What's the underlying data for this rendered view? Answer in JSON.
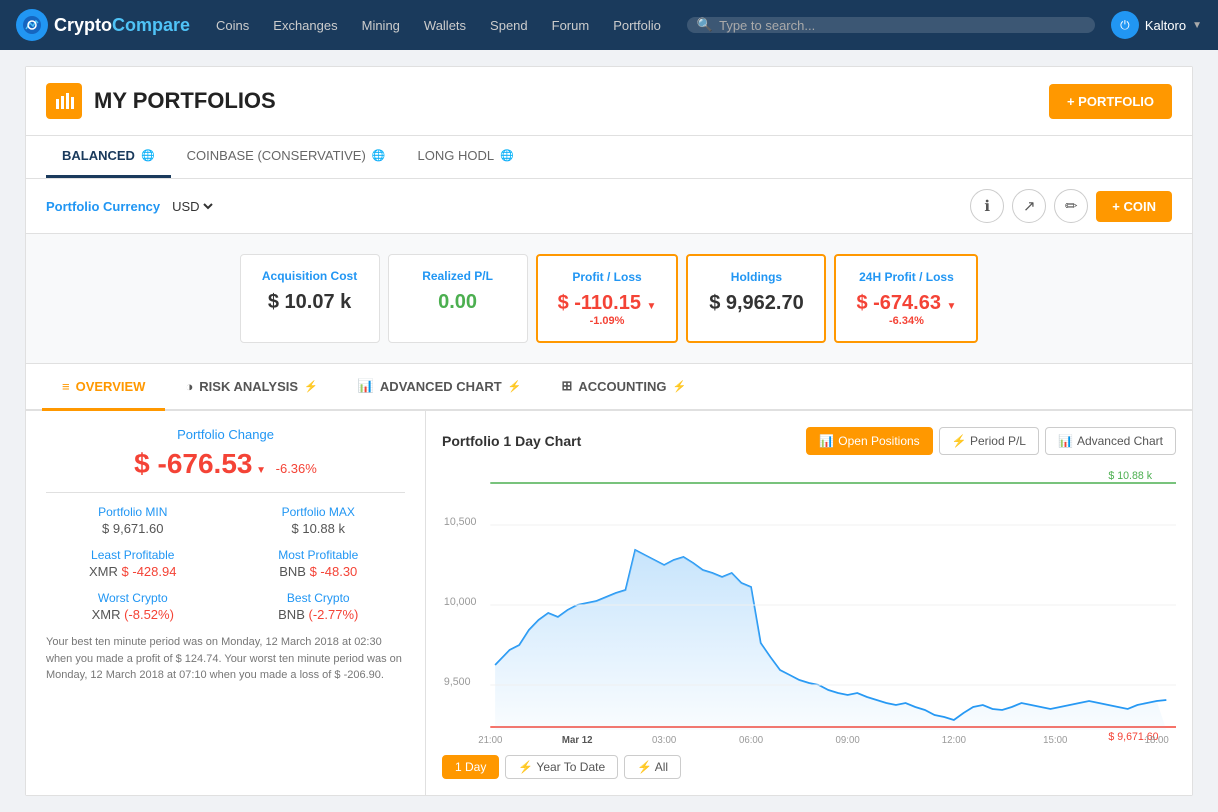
{
  "nav": {
    "logo_crypto": "Crypto",
    "logo_compare": "Compare",
    "logo_icon": "📊",
    "items": [
      "Coins",
      "Exchanges",
      "Mining",
      "Wallets",
      "Spend",
      "Forum",
      "Portfolio"
    ],
    "search_placeholder": "Type to search...",
    "user": "Kaltoro"
  },
  "page": {
    "title": "MY PORTFOLIOS",
    "add_portfolio_btn": "+ PORTFOLIO"
  },
  "portfolio_tabs": [
    {
      "label": "BALANCED",
      "active": true
    },
    {
      "label": "COINBASE (CONSERVATIVE)",
      "active": false
    },
    {
      "label": "LONG HODL",
      "active": false
    }
  ],
  "controls": {
    "currency_label": "Portfolio Currency",
    "currency_value": "USD",
    "add_coin_btn": "+ COIN"
  },
  "stats": [
    {
      "label": "Acquisition Cost",
      "value": "$ 10.07 k",
      "class": "normal"
    },
    {
      "label": "Realized P/L",
      "value": "0.00",
      "class": "green"
    },
    {
      "label": "Profit / Loss",
      "value": "$ -110.15",
      "sub": "-1.09%",
      "class": "red",
      "highlight": true
    },
    {
      "label": "Holdings",
      "value": "$ 9,962.70",
      "class": "normal",
      "highlight": true
    },
    {
      "label": "24H Profit / Loss",
      "value": "$ -674.63",
      "sub": "-6.34%",
      "class": "red",
      "highlight": true
    }
  ],
  "main_tabs": [
    {
      "label": "OVERVIEW",
      "icon": "≡",
      "active": true
    },
    {
      "label": "RISK ANALYSIS",
      "icon": "◑",
      "bolt": true
    },
    {
      "label": "ADVANCED CHART",
      "icon": "📊",
      "bolt": true
    },
    {
      "label": "ACCOUNTING",
      "icon": "⊞",
      "bolt": true
    }
  ],
  "overview": {
    "change_title": "Portfolio Change",
    "change_value": "$ -676.53",
    "change_pct": "-6.36%",
    "portfolio_min_label": "Portfolio MIN",
    "portfolio_min_value": "$ 9,671.60",
    "portfolio_max_label": "Portfolio MAX",
    "portfolio_max_value": "$ 10.88 k",
    "least_profitable_label": "Least Profitable",
    "least_profitable_coin": "XMR",
    "least_profitable_value": "$ -428.94",
    "most_profitable_label": "Most Profitable",
    "most_profitable_coin": "BNB",
    "most_profitable_value": "$ -48.30",
    "worst_crypto_label": "Worst Crypto",
    "worst_crypto_coin": "XMR",
    "worst_crypto_pct": "(-8.52%)",
    "best_crypto_label": "Best Crypto",
    "best_crypto_coin": "BNB",
    "best_crypto_pct": "(-2.77%)",
    "info_text": "Your best ten minute period was on Monday, 12 March 2018 at 02:30 when you made a profit of $ 124.74. Your worst ten minute period was on Monday, 12 March 2018 at 07:10 when you made a loss of $ -206.90."
  },
  "chart": {
    "title": "Portfolio 1 Day Chart",
    "btn_open_positions": "Open Positions",
    "btn_period_pl": "⚡ Period P/L",
    "btn_advanced_chart": "Advanced Chart",
    "max_label": "$ 10.88 k",
    "min_label": "$ 9,671.60",
    "time_labels": [
      "21:00",
      "Mar 12",
      "03:00",
      "06:00",
      "09:00",
      "12:00",
      "15:00",
      "18:00"
    ],
    "y_labels": [
      "10,500",
      "10,000",
      "9,500"
    ],
    "time_buttons": [
      "1 Day",
      "⚡ Year To Date",
      "⚡ All"
    ]
  }
}
